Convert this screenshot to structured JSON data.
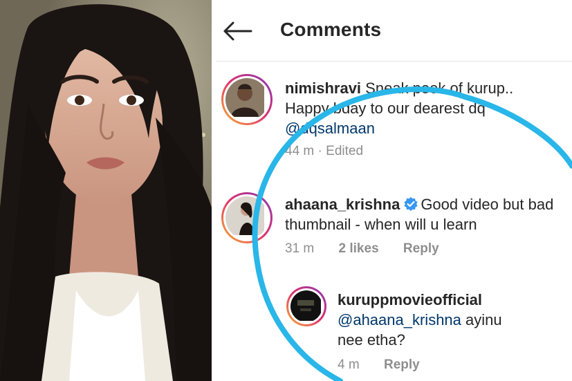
{
  "header": {
    "title": "Comments",
    "back_icon": "arrow-left-icon"
  },
  "comments": [
    {
      "username": "nimishravi",
      "text": "Sneak peek of kurup..",
      "text_line2": "Happy bday to our dearest dq",
      "mention": "@dqsalmaan",
      "time": "44 m",
      "edited": "Edited"
    },
    {
      "username": "ahaana_krishna",
      "verified": true,
      "text": "Good video but bad",
      "text_line2": "thumbnail - when will u learn",
      "time": "31 m",
      "likes": "2 likes",
      "reply_label": "Reply"
    },
    {
      "username": "kuruppmovieofficial",
      "mention": "@ahaana_krishna",
      "text": "ayinu",
      "text_line2": "nee etha?",
      "time": "4 m",
      "reply_label": "Reply"
    }
  ],
  "colors": {
    "highlight_circle": "#29b6e8",
    "mention": "#00376b",
    "verified": "#3897f0",
    "meta_gray": "#8e8e8e"
  }
}
